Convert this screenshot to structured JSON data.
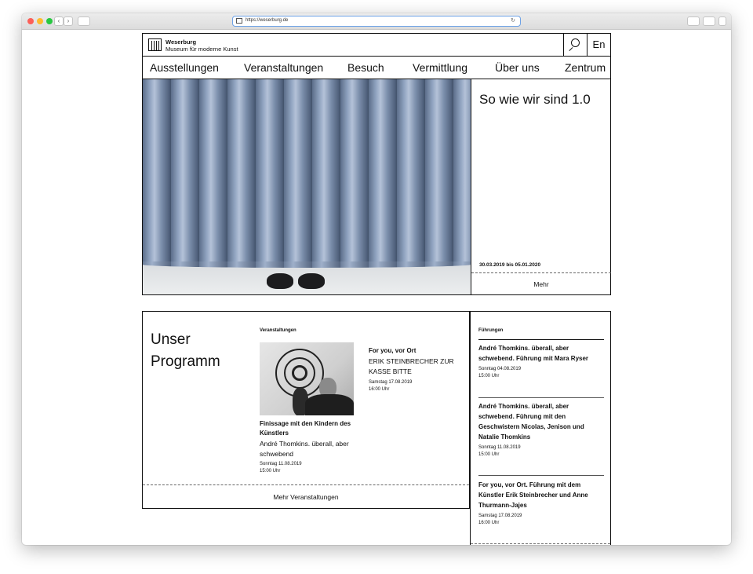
{
  "browser": {
    "url": "https://weserburg.de",
    "nav_back": "‹",
    "nav_forward": "›",
    "reload_icon": "↻"
  },
  "header": {
    "logo_title": "Weserburg",
    "logo_subtitle": "Museum für moderne Kunst",
    "lang": "En"
  },
  "nav": [
    "Ausstellungen",
    "Veranstaltungen",
    "Besuch",
    "Vermittlung",
    "Über uns",
    "Zentrum"
  ],
  "hero": {
    "title": "So wie wir sind 1.0",
    "date": "30.03.2019 bis 05.01.2020",
    "more": "Mehr"
  },
  "program": {
    "title": "Unser Programm",
    "events_label": "Veranstaltungen",
    "event1": {
      "title": "Finissage mit den Kindern des Künstlers",
      "subtitle": "André Thomkins. überall, aber schwebend",
      "date": "Sonntag 11.08.2019",
      "time": "15:00 Uhr"
    },
    "event2": {
      "title": "For you, vor Ort",
      "subtitle": "ERIK STEINBRECHER ZUR KASSE BITTE",
      "date": "Samstag 17.08.2019",
      "time": "16:00 Uhr"
    },
    "more_events": "Mehr Veranstaltungen",
    "tours_label": "Führungen",
    "tours": [
      {
        "title": "André Thomkins. überall, aber schwebend. Führung mit Mara Ryser",
        "date": "Sonntag 04.08.2019",
        "time": "15:00 Uhr"
      },
      {
        "title": "André Thomkins. überall, aber schwebend. Führung mit den Geschwistern Nicolas, Jenison und Natalie Thomkins",
        "date": "Sonntag 11.08.2019",
        "time": "15:00 Uhr"
      },
      {
        "title": "For you, vor Ort. Führung mit dem Künstler Erik Steinbrecher und Anne Thurmann-Jajes",
        "date": "Samstag 17.08.2019",
        "time": "16:00 Uhr"
      }
    ]
  },
  "colors": {
    "accent_blue": "#6ea2e6",
    "border": "#111111"
  }
}
